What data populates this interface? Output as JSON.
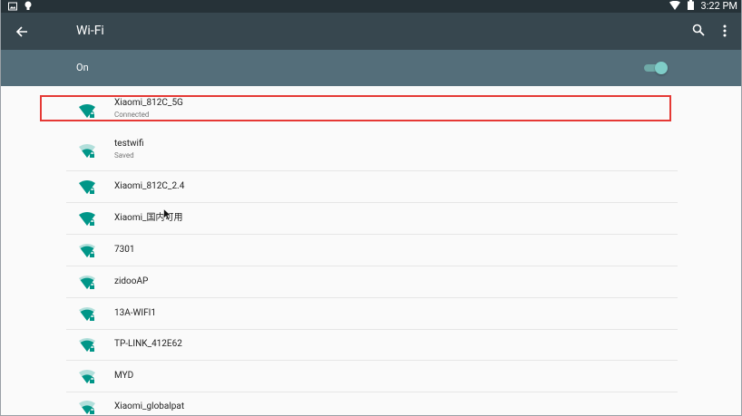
{
  "status_bar": {
    "time": "3:22 PM",
    "icons": [
      "image-icon",
      "bulb-icon",
      "wifi-status-icon",
      "battery-icon"
    ]
  },
  "toolbar": {
    "title": "Wi-Fi",
    "icons": [
      "back-arrow-icon",
      "search-icon",
      "more-vert-icon"
    ]
  },
  "master": {
    "label": "On",
    "enabled": true
  },
  "networks": [
    {
      "name": "Xiaomi_812C_5G",
      "status": "Connected",
      "signal": 4,
      "secured": true
    },
    {
      "name": "testwifi",
      "status": "Saved",
      "signal": 2,
      "secured": true
    },
    {
      "name": "Xiaomi_812C_2.4",
      "status": "",
      "signal": 4,
      "secured": true
    },
    {
      "name": "Xiaomi_国内可用",
      "status": "",
      "signal": 4,
      "secured": true
    },
    {
      "name": "7301",
      "status": "",
      "signal": 3,
      "secured": true
    },
    {
      "name": "zidooAP",
      "status": "",
      "signal": 3,
      "secured": true
    },
    {
      "name": "13A-WIFI1",
      "status": "",
      "signal": 3,
      "secured": true
    },
    {
      "name": "TP-LINK_412E62",
      "status": "",
      "signal": 3,
      "secured": true
    },
    {
      "name": "MYD",
      "status": "",
      "signal": 2,
      "secured": true
    },
    {
      "name": "Xiaomi_globalpat",
      "status": "",
      "signal": 2,
      "secured": true
    }
  ],
  "colors": {
    "status_bar": "#263238",
    "toolbar": "#37474f",
    "master_bar": "#546e7a",
    "accent": "#009688",
    "highlight": "#e53935"
  }
}
